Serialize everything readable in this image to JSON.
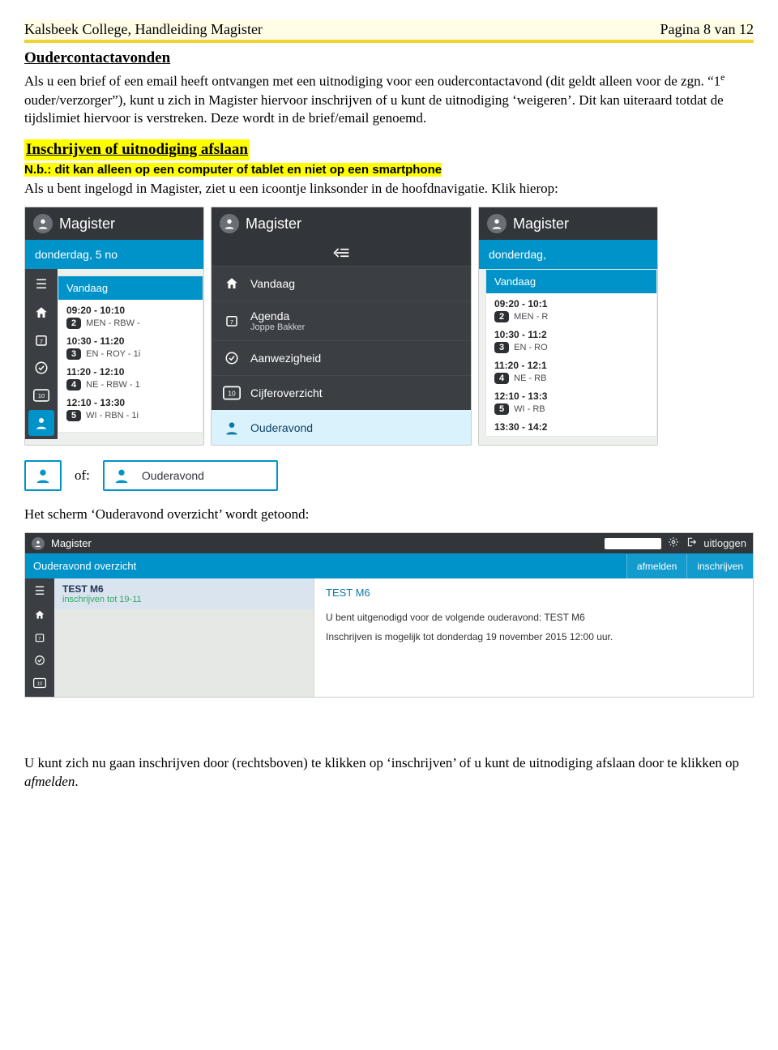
{
  "header": {
    "left": "Kalsbeek College, Handleiding Magister",
    "right": "Pagina 8 van 12"
  },
  "section1": {
    "title": "Oudercontactavonden",
    "p1a": "Als u een brief of een email heeft ontvangen met een uitnodiging voor een oudercontactavond (dit geldt alleen voor de zgn. “1",
    "sup": "e",
    "p1b": " ouder/verzorger”), kunt u zich in Magister hiervoor inschrijven of u kunt de uitnodiging ‘weigeren’. Dit kan uiteraard totdat de tijdslimiet hiervoor is verstreken. Deze wordt in de brief/email genoemd."
  },
  "section2": {
    "title": "Inschrijven of uitnodiging afslaan",
    "nb_label": "N.b.: dit kan alleen op een computer of tablet en niet op een smartphone",
    "lead": "Als u bent ingelogd in Magister, ziet u een icoontje linksonder in de hoofdnavigatie. Klik hierop:"
  },
  "magister": {
    "appname": "Magister",
    "date_a": "donderdag, 5 no",
    "date_c": "donderdag,",
    "card_title": "Vandaag",
    "scheduleA": [
      {
        "time": "09:20 - 10:10",
        "num": "2",
        "text": "MEN - RBW -"
      },
      {
        "time": "10:30 - 11:20",
        "num": "3",
        "text": "EN - ROY - 1i"
      },
      {
        "time": "11:20 - 12:10",
        "num": "4",
        "text": "NE - RBW - 1"
      },
      {
        "time": "12:10 - 13:30",
        "num": "5",
        "text": "WI - RBN - 1i"
      }
    ],
    "scheduleC": [
      {
        "time": "09:20 - 10:1",
        "num": "2",
        "text": "MEN - R"
      },
      {
        "time": "10:30 - 11:2",
        "num": "3",
        "text": "EN - RO"
      },
      {
        "time": "11:20 - 12:1",
        "num": "4",
        "text": "NE - RB"
      },
      {
        "time": "12:10 - 13:3",
        "num": "5",
        "text": "WI - RB"
      },
      {
        "time": "13:30 - 14:2",
        "num": "",
        "text": ""
      }
    ],
    "nav": {
      "items": [
        {
          "icon": "home",
          "label": "Vandaag",
          "sub": ""
        },
        {
          "icon": "cal",
          "label": "Agenda",
          "sub": "Joppe Bakker"
        },
        {
          "icon": "check",
          "label": "Aanwezigheid",
          "sub": ""
        },
        {
          "icon": "ten",
          "label": "Cijferoverzicht",
          "sub": ""
        },
        {
          "icon": "person",
          "label": "Ouderavond",
          "sub": "",
          "selected": true
        }
      ]
    }
  },
  "callouts": {
    "of": "of:",
    "label": "Ouderavond"
  },
  "overview": {
    "caption": "Het scherm ‘Ouderavond overzicht’ wordt getoond:",
    "appname": "Magister",
    "logout": "uitloggen",
    "barTitle": "Ouderavond overzicht",
    "btnAfmelden": "afmelden",
    "btnInschrijven": "inschrijven",
    "side": {
      "title": "TEST M6",
      "sub": "inschrijven tot 19-11"
    },
    "main": {
      "title": "TEST M6",
      "line1": "U bent uitgenodigd voor de volgende ouderavond: TEST M6",
      "line2": "Inschrijven is mogelijk tot donderdag 19 november 2015 12:00 uur."
    }
  },
  "footer": {
    "p": "U kunt zich nu gaan inschrijven door (rechtsboven) te klikken op ‘inschrijven’ of  u kunt de uitnodiging afslaan door te klikken op ",
    "em": "afmelden",
    "tail": "."
  }
}
